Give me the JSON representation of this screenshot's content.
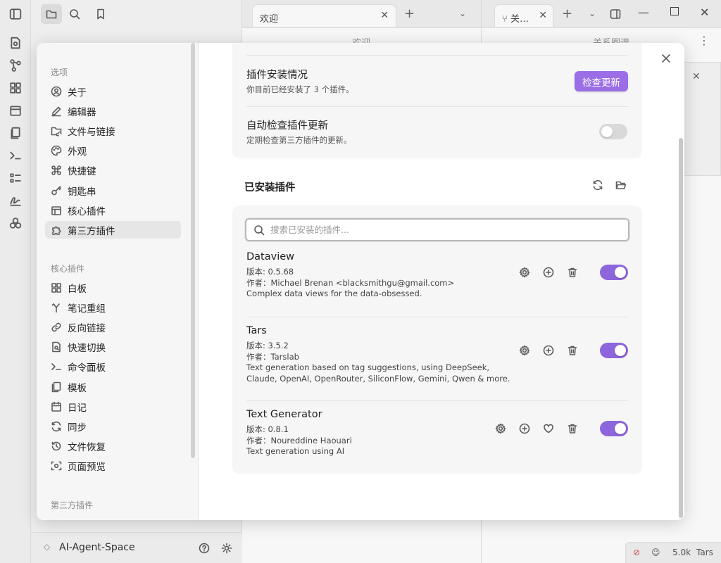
{
  "background": {
    "left_tabbar": {},
    "mid_tab": {
      "title": "欢迎",
      "header": "欢迎"
    },
    "right_tab": {
      "title": "关…",
      "header": "关系图谱"
    },
    "vault_name": "AI-Agent-Space",
    "status": {
      "word_count": "5.0k",
      "plugin": "Tars"
    }
  },
  "modal": {
    "nav": {
      "options_header": "选项",
      "options": [
        {
          "label": "关于",
          "icon": "user-circle-icon"
        },
        {
          "label": "编辑器",
          "icon": "pencil-icon"
        },
        {
          "label": "文件与链接",
          "icon": "folder-link-icon"
        },
        {
          "label": "外观",
          "icon": "palette-icon"
        },
        {
          "label": "快捷键",
          "icon": "command-icon"
        },
        {
          "label": "钥匙串",
          "icon": "key-icon"
        },
        {
          "label": "核心插件",
          "icon": "core-plugin-icon"
        },
        {
          "label": "第三方插件",
          "icon": "puzzle-icon"
        }
      ],
      "core_header": "核心插件",
      "core": [
        {
          "label": "白板",
          "icon": "canvas-icon"
        },
        {
          "label": "笔记重组",
          "icon": "merge-icon"
        },
        {
          "label": "反向链接",
          "icon": "backlink-icon"
        },
        {
          "label": "快速切换",
          "icon": "quick-switch-icon"
        },
        {
          "label": "命令面板",
          "icon": "terminal-icon"
        },
        {
          "label": "模板",
          "icon": "template-icon"
        },
        {
          "label": "日记",
          "icon": "calendar-icon"
        },
        {
          "label": "同步",
          "icon": "sync-icon"
        },
        {
          "label": "文件恢复",
          "icon": "history-icon"
        },
        {
          "label": "页面预览",
          "icon": "preview-icon"
        }
      ],
      "third_header": "第三方插件",
      "active_index": 7
    },
    "install_status": {
      "title": "插件安装情况",
      "desc": "你目前已经安装了 3 个插件。",
      "button": "检查更新"
    },
    "auto_update": {
      "title": "自动检查插件更新",
      "desc": "定期检查第三方插件的更新。",
      "enabled": false
    },
    "installed": {
      "title": "已安装插件",
      "search_placeholder": "搜索已安装的插件...",
      "plugins": [
        {
          "name": "Dataview",
          "version": "版本: 0.5.68",
          "author": "作者：Michael Brenan <blacksmithgu@gmail.com>",
          "desc": [
            "Complex data views for the data-obsessed."
          ],
          "enabled": true,
          "donate": false
        },
        {
          "name": "Tars",
          "version": "版本: 3.5.2",
          "author": "作者：Tarslab",
          "desc": [
            "Text generation based on tag suggestions, using DeepSeek,",
            "Claude, OpenAI, OpenRouter, SiliconFlow, Gemini, Qwen & more."
          ],
          "enabled": true,
          "donate": false
        },
        {
          "name": "Text Generator",
          "version": "版本: 0.8.1",
          "author": "作者：Noureddine Haouari",
          "desc": [
            "Text generation using AI"
          ],
          "enabled": true,
          "donate": true
        }
      ]
    }
  },
  "colors": {
    "accent": "#9b6ee8",
    "toggle_on": "#8d65dd"
  }
}
